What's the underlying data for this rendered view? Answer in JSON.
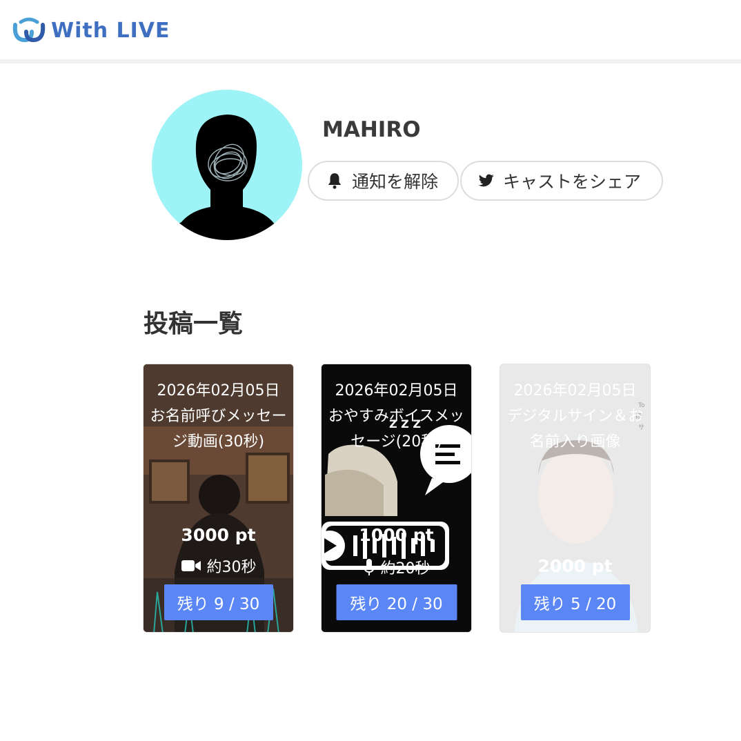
{
  "header": {
    "logo_text": "With LIVE"
  },
  "profile": {
    "name": "MAHIRO",
    "notify_label": "通知を解除",
    "share_label": "キャストをシェア"
  },
  "posts_title": "投稿一覧",
  "posts": [
    {
      "date": "2026年02月05日",
      "title": "お名前呼びメッセージ動画(30秒)",
      "price": "3000 pt",
      "meta": "約30秒",
      "meta_icon": "video-camera-icon",
      "remaining": "残り 9 / 30"
    },
    {
      "date": "2026年02月05日",
      "title": "おやすみボイスメッセージ(20秒)",
      "price": "1000 pt",
      "meta": "約20秒",
      "meta_icon": "microphone-icon",
      "remaining": "残り 20 / 30"
    },
    {
      "date": "2026年02月05日",
      "title": "デジタルサイン＆お名前入り画像",
      "price": "2000 pt",
      "meta": "",
      "meta_icon": "",
      "remaining": "残り 5 / 20"
    }
  ],
  "colors": {
    "accent": "#5b86f5",
    "logo": "#3f6fc0",
    "avatar_bg": "#9ef3f6"
  }
}
